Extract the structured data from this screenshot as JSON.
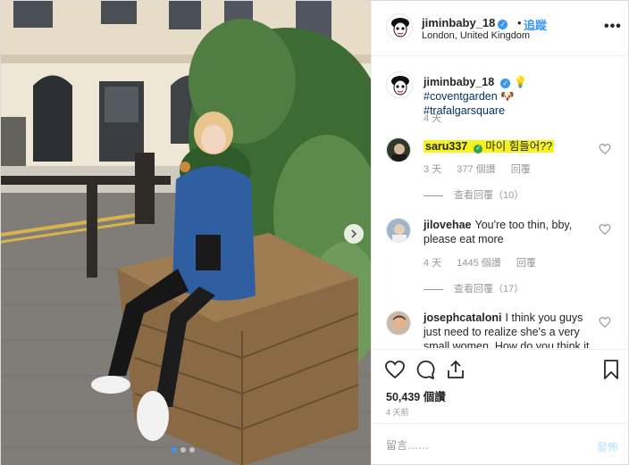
{
  "post": {
    "username": "jiminbaby_18",
    "follow_label": "追蹤",
    "location": "London, United Kingdom",
    "more_label": "•••",
    "likes_count": "50,439 個讚",
    "time_ago": "4 天前",
    "carousel": {
      "total": 3,
      "active": 0
    }
  },
  "caption": {
    "username": "jiminbaby_18",
    "text_hash1": "#coventgarden",
    "text_hash2": "#trafalgarsquare",
    "time": "4 天"
  },
  "comments": [
    {
      "username": "saru337",
      "text": "마이 힘들어??",
      "time": "3 天",
      "likes": "377 個讚",
      "reply_label": "回覆",
      "view_replies": "查看回覆（10）",
      "highlight": true
    },
    {
      "username": "jilovehae",
      "text": "You're too thin, bby, please eat more",
      "time": "4 天",
      "likes": "1445 個讚",
      "reply_label": "回覆",
      "view_replies": "查看回覆（17）"
    },
    {
      "username": "josephcataloni",
      "text": "I think you guys just need to realize she's a very small women. How do you think it"
    }
  ],
  "add_comment": {
    "placeholder": "留言……",
    "post_label": "發佈"
  },
  "colors": {
    "accent": "#3897f0",
    "highlight": "#f5f31e",
    "muted": "#999999"
  },
  "icons": [
    "heart-icon",
    "comment-icon",
    "share-icon",
    "bookmark-icon",
    "more-icon",
    "next-arrow-icon",
    "verified-icon",
    "lightbulb-emoji",
    "cartoon-emoji"
  ]
}
